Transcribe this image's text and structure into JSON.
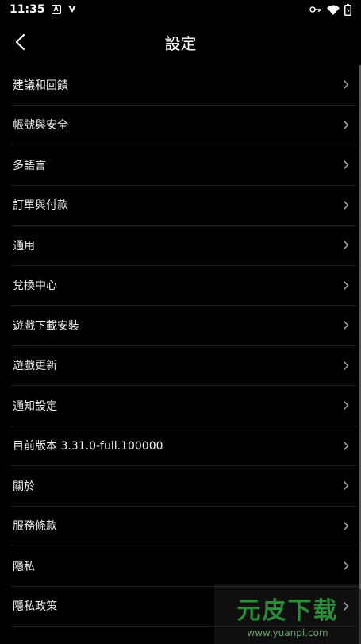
{
  "status_bar": {
    "time": "11:35",
    "notification_icons": [
      "a-box-icon",
      "v-logo-icon"
    ],
    "system_icons": [
      "key-icon",
      "wifi-icon",
      "battery-icon"
    ]
  },
  "header": {
    "title": "設定",
    "back_icon": "chevron-left-icon"
  },
  "settings": {
    "items": [
      {
        "label": "建議和回饋"
      },
      {
        "label": "帳號與安全"
      },
      {
        "label": "多語言"
      },
      {
        "label": "訂單與付款"
      },
      {
        "label": "通用"
      },
      {
        "label": "兌換中心"
      },
      {
        "label": "遊戲下載安裝"
      },
      {
        "label": "遊戲更新"
      },
      {
        "label": "通知設定"
      },
      {
        "label": "目前版本 3.31.0-full.100000"
      },
      {
        "label": "關於"
      },
      {
        "label": "服務條款"
      },
      {
        "label": "隱私"
      },
      {
        "label": "隱私政策"
      }
    ]
  },
  "watermark": {
    "logo": "元皮下载",
    "url": "www.yuanpi.com"
  },
  "colors": {
    "background": "#000000",
    "text": "#ffffff",
    "divider": "#1e1e1e",
    "chevron": "#9a9a9a"
  }
}
